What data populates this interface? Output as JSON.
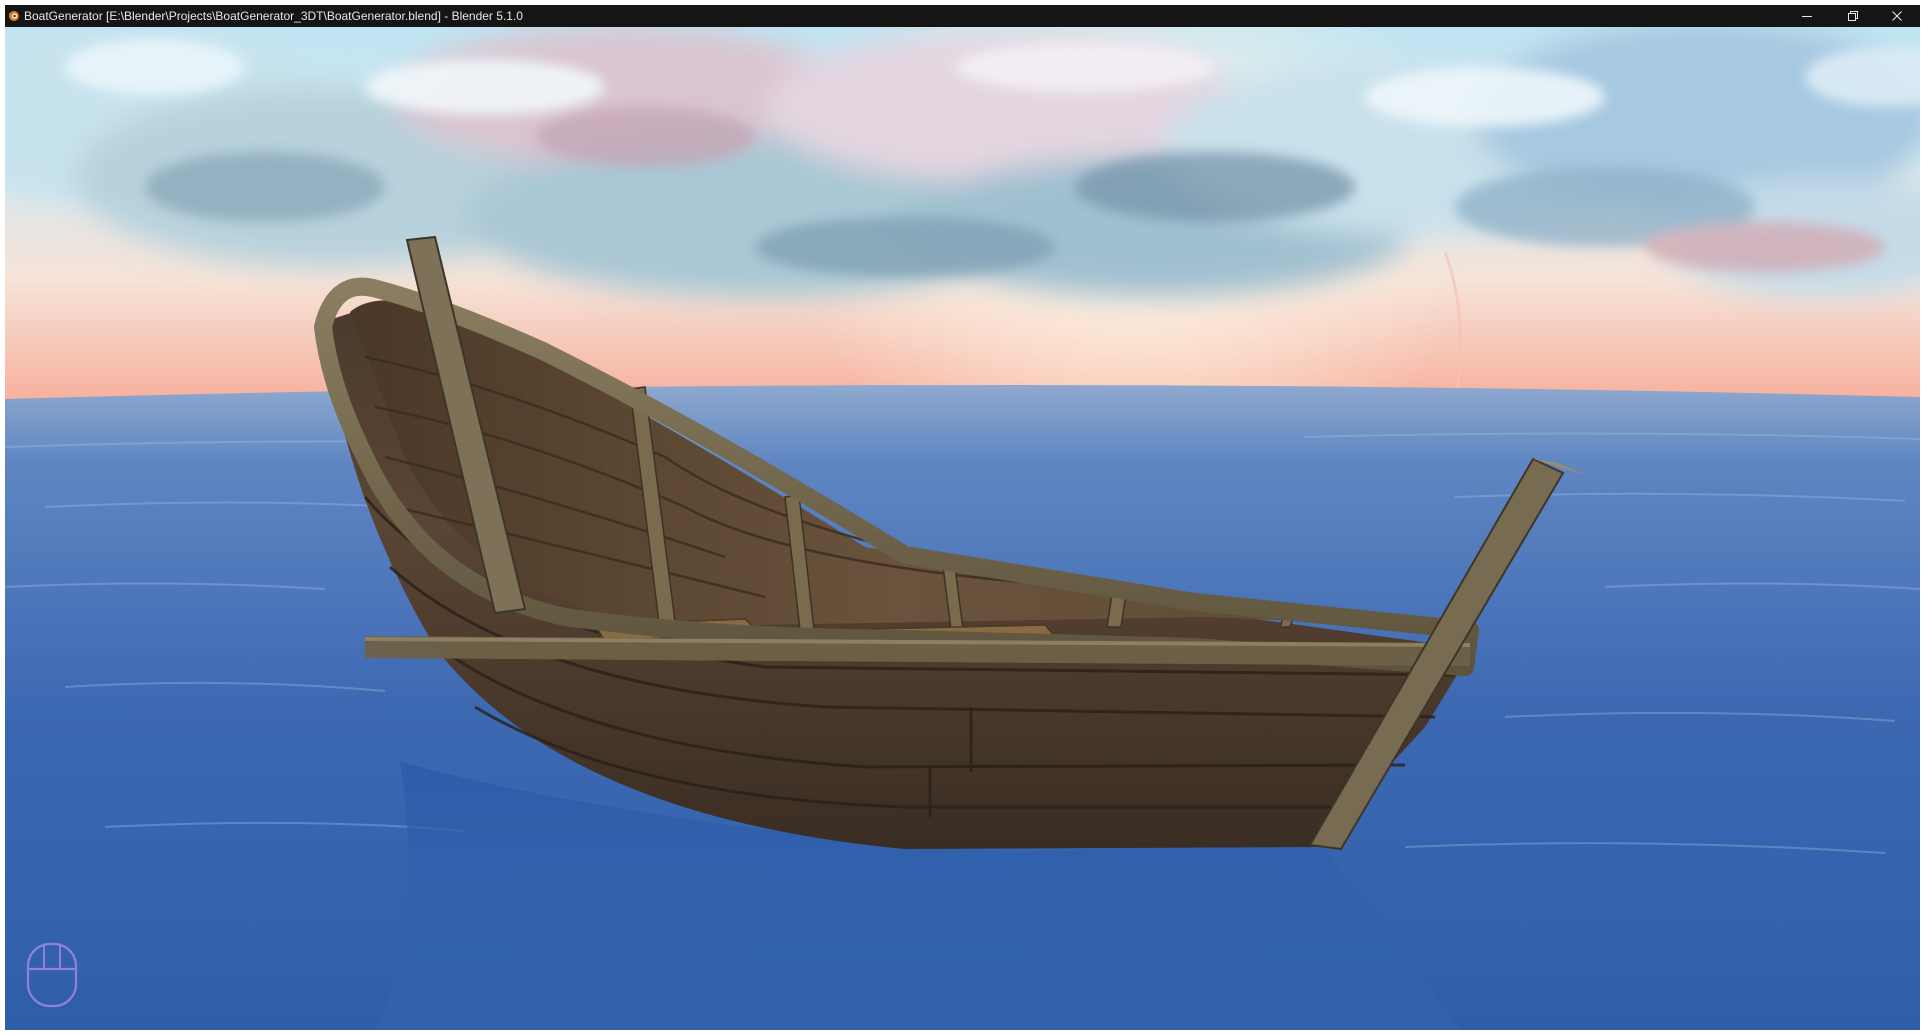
{
  "window": {
    "title": "BoatGenerator [E:\\Blender\\Projects\\BoatGenerator_3DT\\BoatGenerator.blend] - Blender 5.1.0",
    "app_icon": "blender-icon",
    "controls": {
      "minimize_icon": "minimize-icon",
      "maximize_icon": "restore-icon",
      "close_icon": "close-icon"
    }
  },
  "viewport": {
    "scene": "rendered-3d-viewport",
    "overlay_icon": "mouse-navigation-icon"
  },
  "colors": {
    "titlebar": "#151515",
    "sky_top": "#cfe6f0",
    "sunset_glow": "#f3a08f",
    "sea": "#3d69b3",
    "hull_wood": "#5a4331",
    "rim_wood": "#6f6348",
    "mouse_icon_stroke": "#8f7fe0"
  }
}
